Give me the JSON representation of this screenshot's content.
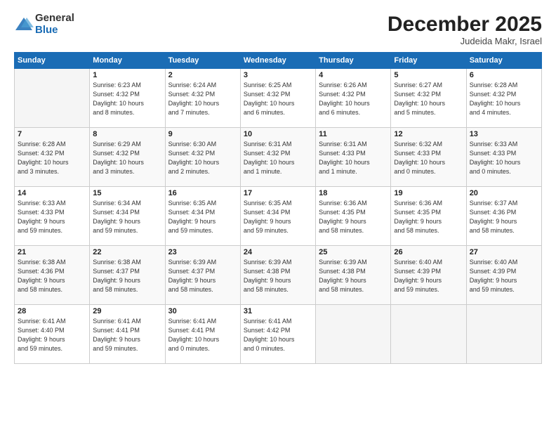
{
  "logo": {
    "general": "General",
    "blue": "Blue"
  },
  "header": {
    "month": "December 2025",
    "location": "Judeida Makr, Israel"
  },
  "days_of_week": [
    "Sunday",
    "Monday",
    "Tuesday",
    "Wednesday",
    "Thursday",
    "Friday",
    "Saturday"
  ],
  "weeks": [
    [
      {
        "day": "",
        "info": ""
      },
      {
        "day": "1",
        "info": "Sunrise: 6:23 AM\nSunset: 4:32 PM\nDaylight: 10 hours\nand 8 minutes."
      },
      {
        "day": "2",
        "info": "Sunrise: 6:24 AM\nSunset: 4:32 PM\nDaylight: 10 hours\nand 7 minutes."
      },
      {
        "day": "3",
        "info": "Sunrise: 6:25 AM\nSunset: 4:32 PM\nDaylight: 10 hours\nand 6 minutes."
      },
      {
        "day": "4",
        "info": "Sunrise: 6:26 AM\nSunset: 4:32 PM\nDaylight: 10 hours\nand 6 minutes."
      },
      {
        "day": "5",
        "info": "Sunrise: 6:27 AM\nSunset: 4:32 PM\nDaylight: 10 hours\nand 5 minutes."
      },
      {
        "day": "6",
        "info": "Sunrise: 6:28 AM\nSunset: 4:32 PM\nDaylight: 10 hours\nand 4 minutes."
      }
    ],
    [
      {
        "day": "7",
        "info": "Sunrise: 6:28 AM\nSunset: 4:32 PM\nDaylight: 10 hours\nand 3 minutes."
      },
      {
        "day": "8",
        "info": "Sunrise: 6:29 AM\nSunset: 4:32 PM\nDaylight: 10 hours\nand 3 minutes."
      },
      {
        "day": "9",
        "info": "Sunrise: 6:30 AM\nSunset: 4:32 PM\nDaylight: 10 hours\nand 2 minutes."
      },
      {
        "day": "10",
        "info": "Sunrise: 6:31 AM\nSunset: 4:32 PM\nDaylight: 10 hours\nand 1 minute."
      },
      {
        "day": "11",
        "info": "Sunrise: 6:31 AM\nSunset: 4:33 PM\nDaylight: 10 hours\nand 1 minute."
      },
      {
        "day": "12",
        "info": "Sunrise: 6:32 AM\nSunset: 4:33 PM\nDaylight: 10 hours\nand 0 minutes."
      },
      {
        "day": "13",
        "info": "Sunrise: 6:33 AM\nSunset: 4:33 PM\nDaylight: 10 hours\nand 0 minutes."
      }
    ],
    [
      {
        "day": "14",
        "info": "Sunrise: 6:33 AM\nSunset: 4:33 PM\nDaylight: 9 hours\nand 59 minutes."
      },
      {
        "day": "15",
        "info": "Sunrise: 6:34 AM\nSunset: 4:34 PM\nDaylight: 9 hours\nand 59 minutes."
      },
      {
        "day": "16",
        "info": "Sunrise: 6:35 AM\nSunset: 4:34 PM\nDaylight: 9 hours\nand 59 minutes."
      },
      {
        "day": "17",
        "info": "Sunrise: 6:35 AM\nSunset: 4:34 PM\nDaylight: 9 hours\nand 59 minutes."
      },
      {
        "day": "18",
        "info": "Sunrise: 6:36 AM\nSunset: 4:35 PM\nDaylight: 9 hours\nand 58 minutes."
      },
      {
        "day": "19",
        "info": "Sunrise: 6:36 AM\nSunset: 4:35 PM\nDaylight: 9 hours\nand 58 minutes."
      },
      {
        "day": "20",
        "info": "Sunrise: 6:37 AM\nSunset: 4:36 PM\nDaylight: 9 hours\nand 58 minutes."
      }
    ],
    [
      {
        "day": "21",
        "info": "Sunrise: 6:38 AM\nSunset: 4:36 PM\nDaylight: 9 hours\nand 58 minutes."
      },
      {
        "day": "22",
        "info": "Sunrise: 6:38 AM\nSunset: 4:37 PM\nDaylight: 9 hours\nand 58 minutes."
      },
      {
        "day": "23",
        "info": "Sunrise: 6:39 AM\nSunset: 4:37 PM\nDaylight: 9 hours\nand 58 minutes."
      },
      {
        "day": "24",
        "info": "Sunrise: 6:39 AM\nSunset: 4:38 PM\nDaylight: 9 hours\nand 58 minutes."
      },
      {
        "day": "25",
        "info": "Sunrise: 6:39 AM\nSunset: 4:38 PM\nDaylight: 9 hours\nand 58 minutes."
      },
      {
        "day": "26",
        "info": "Sunrise: 6:40 AM\nSunset: 4:39 PM\nDaylight: 9 hours\nand 59 minutes."
      },
      {
        "day": "27",
        "info": "Sunrise: 6:40 AM\nSunset: 4:39 PM\nDaylight: 9 hours\nand 59 minutes."
      }
    ],
    [
      {
        "day": "28",
        "info": "Sunrise: 6:41 AM\nSunset: 4:40 PM\nDaylight: 9 hours\nand 59 minutes."
      },
      {
        "day": "29",
        "info": "Sunrise: 6:41 AM\nSunset: 4:41 PM\nDaylight: 9 hours\nand 59 minutes."
      },
      {
        "day": "30",
        "info": "Sunrise: 6:41 AM\nSunset: 4:41 PM\nDaylight: 10 hours\nand 0 minutes."
      },
      {
        "day": "31",
        "info": "Sunrise: 6:41 AM\nSunset: 4:42 PM\nDaylight: 10 hours\nand 0 minutes."
      },
      {
        "day": "",
        "info": ""
      },
      {
        "day": "",
        "info": ""
      },
      {
        "day": "",
        "info": ""
      }
    ]
  ]
}
